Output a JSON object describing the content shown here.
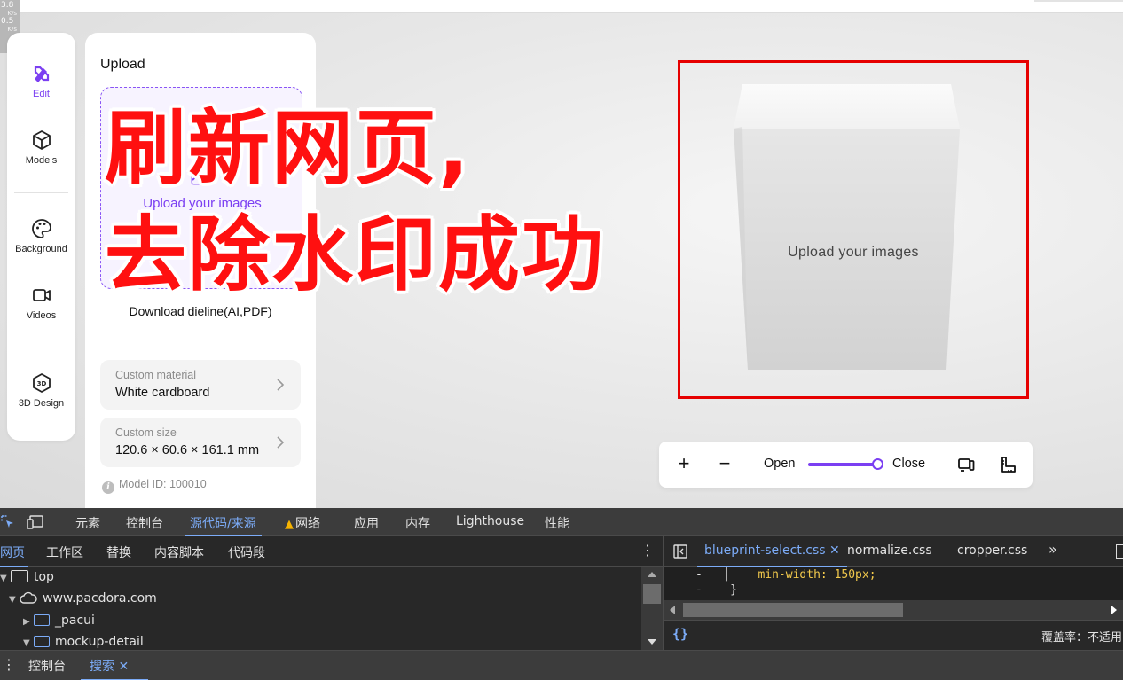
{
  "net_meter": {
    "lines": [
      "3.8",
      "K/s",
      "0.5",
      "K/s"
    ]
  },
  "rail": {
    "items": [
      {
        "label": "Edit",
        "icon": "edit-tools-icon",
        "active": true
      },
      {
        "label": "Models",
        "icon": "cube-icon"
      },
      {
        "label": "Background",
        "icon": "palette-icon"
      },
      {
        "label": "Videos",
        "icon": "video-camera-icon"
      },
      {
        "label": "3D Design",
        "icon": "3d-design-icon"
      }
    ]
  },
  "panel": {
    "title": "Upload",
    "dropzone_text": "Upload your images",
    "dieline_link": "Download dieline(AI,PDF)",
    "material": {
      "label": "Custom material",
      "value": "White cardboard"
    },
    "size": {
      "label": "Custom size",
      "value": "120.6 × 60.6 × 161.1 mm"
    },
    "model_id": "Model ID: 100010"
  },
  "watermark": {
    "line1": "刷新网页,",
    "line2": "去除水印成功",
    "color": "#ff1010"
  },
  "preview": {
    "box_text": "Upload your images",
    "frame_color": "#e60000"
  },
  "zoom_bar": {
    "plus": "+",
    "minus": "−",
    "open": "Open",
    "close": "Close",
    "slider_fraction": 1.0
  },
  "devtools": {
    "main_tabs": [
      "元素",
      "控制台",
      "源代码/来源",
      "网络",
      "应用",
      "内存",
      "Lighthouse",
      "性能"
    ],
    "active_main_tab": "源代码/来源",
    "sub_tabs": [
      "网页",
      "工作区",
      "替换",
      "内容脚本",
      "代码段"
    ],
    "active_sub_tab": "网页",
    "tree": [
      "top",
      "www.pacdora.com",
      "_pacui",
      "mockup-detail"
    ],
    "editor_tabs": [
      "blueprint-select.css",
      "normalize.css",
      "cropper.css"
    ],
    "active_editor_tab": "blueprint-select.css",
    "more_tabs": "»",
    "code": [
      {
        "prefix": "-",
        "text": "min-width",
        "value": "150px"
      },
      {
        "prefix": "-",
        "text": "}"
      }
    ],
    "format_button": "{}",
    "coverage": "覆盖率：不适用",
    "drawer_tabs": [
      "控制台",
      "搜索"
    ],
    "active_drawer_tab": "搜索"
  },
  "colors": {
    "accent": "#7b3ff2",
    "devtools_accent": "#7cacf8",
    "devtools_bg": "#282828"
  }
}
